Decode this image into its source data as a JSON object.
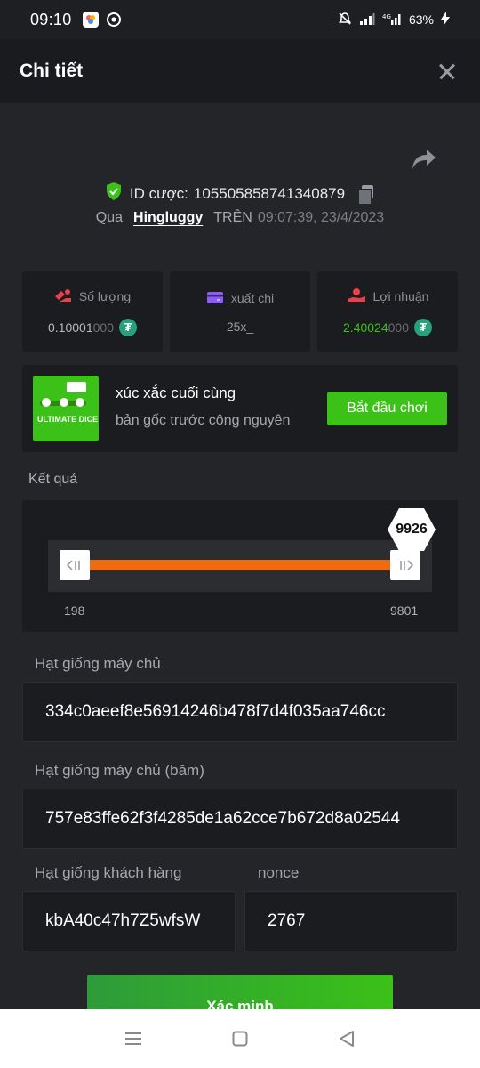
{
  "status_bar": {
    "time": "09:10",
    "battery": "63%"
  },
  "header": {
    "title": "Chi tiết"
  },
  "bet": {
    "id_label": "ID cược:",
    "id_value": "105505858741340879",
    "by_label": "Qua",
    "username": "Hingluggy",
    "on_label": "TRÊN",
    "timestamp": "09:07:39, 23/4/2023"
  },
  "stats": {
    "amount": {
      "label": "Số lượng",
      "value_main": "0.10001",
      "value_dim": "000"
    },
    "payout": {
      "label": "xuất chi",
      "value": "25x_"
    },
    "profit": {
      "label": "Lợi nhuận",
      "value_main": "2.40024",
      "value_dim": "000"
    }
  },
  "game": {
    "thumb_text": "ULTIMATE DICE",
    "name": "xúc xắc cuối cùng",
    "subtitle": "bản gốc trước công nguyên",
    "play_label": "Bắt đầu chơi"
  },
  "result": {
    "label": "Kết quả",
    "value": "9926",
    "range_min": "198",
    "range_max": "9801"
  },
  "fields": {
    "server_seed_label": "Hạt giống máy chủ",
    "server_seed_value": "334c0aeef8e56914246b478f7d4f035aa746cc",
    "server_seed_hashed_label": "Hạt giống máy chủ (băm)",
    "server_seed_hashed_value": "757e83ffe62f3f4285de1a62cce7b672d8a02544",
    "client_seed_label": "Hạt giống khách hàng",
    "client_seed_value": "kbA40c47h7Z5wfsW",
    "nonce_label": "nonce",
    "nonce_value": "2767"
  },
  "verify_label": "Xác minh",
  "colors": {
    "accent_green": "#3bc117",
    "result_orange": "#f06b0d",
    "panel": "#1b1c1f",
    "background": "#232529"
  }
}
